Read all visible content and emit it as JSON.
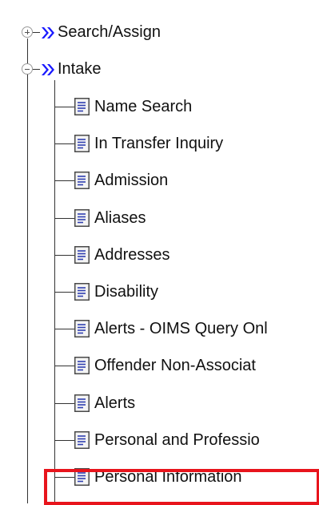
{
  "tree": {
    "folders": [
      {
        "label": "Search/Assign",
        "state": "collapsed",
        "icon": "blue-chevron-icon"
      },
      {
        "label": "Intake",
        "state": "expanded",
        "icon": "blue-chevron-icon"
      }
    ],
    "intake_items": [
      {
        "label": "Name Search",
        "icon": "document-icon"
      },
      {
        "label": "In Transfer Inquiry",
        "icon": "document-icon"
      },
      {
        "label": "Admission",
        "icon": "document-icon"
      },
      {
        "label": "Aliases",
        "icon": "document-icon"
      },
      {
        "label": "Addresses",
        "icon": "document-icon"
      },
      {
        "label": "Disability",
        "icon": "document-icon"
      },
      {
        "label": "Alerts - OIMS Query Onl",
        "icon": "document-icon"
      },
      {
        "label": "Offender Non-Associat",
        "icon": "document-icon"
      },
      {
        "label": "Alerts",
        "icon": "document-icon"
      },
      {
        "label": "Personal and Professio",
        "icon": "document-icon"
      },
      {
        "label": "Personal Information",
        "icon": "document-icon",
        "highlighted": true
      }
    ]
  },
  "colors": {
    "chevron": "#1a1aff",
    "highlight": "#e8141c",
    "connector": "#333333",
    "document_border": "#4a4a4a",
    "document_lines": "#2f3fb0"
  }
}
